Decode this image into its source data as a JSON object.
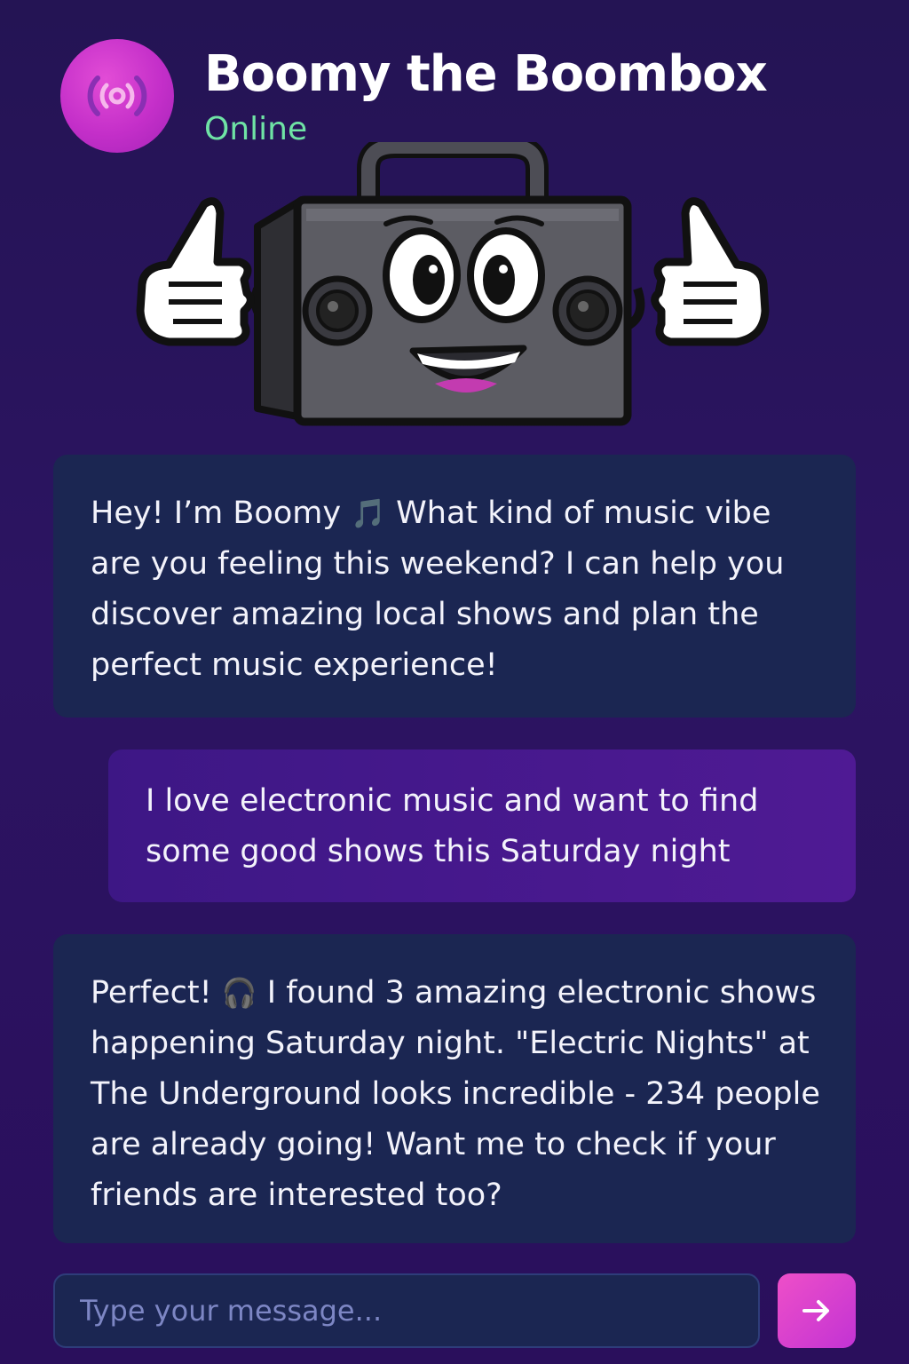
{
  "header": {
    "title": "Boomy the Boombox",
    "status": "Online",
    "avatar_icon": "broadcast-radio-icon"
  },
  "messages": [
    {
      "sender": "bot",
      "parts": [
        "Hey! I’m Boomy ",
        "What kind of music vibe are you feeling this weekend? I can help you discover amazing local shows and plan the perfect music experience!"
      ],
      "emoji": "🎵"
    },
    {
      "sender": "user",
      "text": "I love electronic music and want to find some good shows this Saturday night"
    },
    {
      "sender": "bot",
      "parts": [
        "Perfect! ",
        "I found 3 amazing electronic shows happening Saturday night. \"Electric Nights\" at The Underground looks incredible - 234 people are already going! Want me to check if your friends are interested too?"
      ],
      "emoji": "🎧"
    }
  ],
  "composer": {
    "placeholder": "Type your message...",
    "send_icon": "arrow-right-icon"
  },
  "colors": {
    "background": "#2a1560",
    "bot_bubble": "#1b2652",
    "user_bubble": "#4a1a92",
    "online": "#6fe3a5",
    "accent": "#e04ccb"
  }
}
